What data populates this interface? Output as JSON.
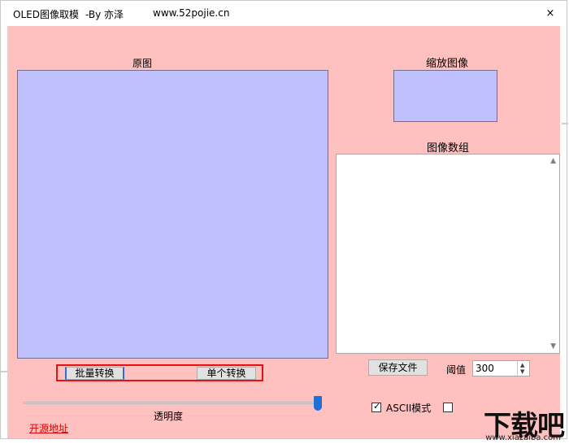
{
  "window": {
    "title": "OLED图像取模",
    "author": "-By 亦泽",
    "site": "www.52pojie.cn",
    "close_glyph": "×"
  },
  "labels": {
    "original": "原图",
    "scaled": "缩放图像",
    "array": "图像数组",
    "transparency": "透明度",
    "threshold": "阈值"
  },
  "buttons": {
    "batch_convert": "批量转换",
    "single_convert": "单个转换",
    "save_file": "保存文件"
  },
  "threshold": {
    "value": "300"
  },
  "slider": {
    "value_fraction": 1.0
  },
  "options": {
    "ascii_mode": {
      "label": "ASCII模式",
      "checked": true
    },
    "second_checkbox": {
      "checked": false
    }
  },
  "link": {
    "open_source": "开源地址"
  },
  "watermark": {
    "main": "下载吧",
    "url": "www.xiazaiba.com"
  },
  "colors": {
    "client_bg": "#ffc0c0",
    "panel_bg": "#c0c0ff",
    "highlight": "#e81010",
    "slider_thumb": "#1e6fd6",
    "link": "#e00000"
  }
}
